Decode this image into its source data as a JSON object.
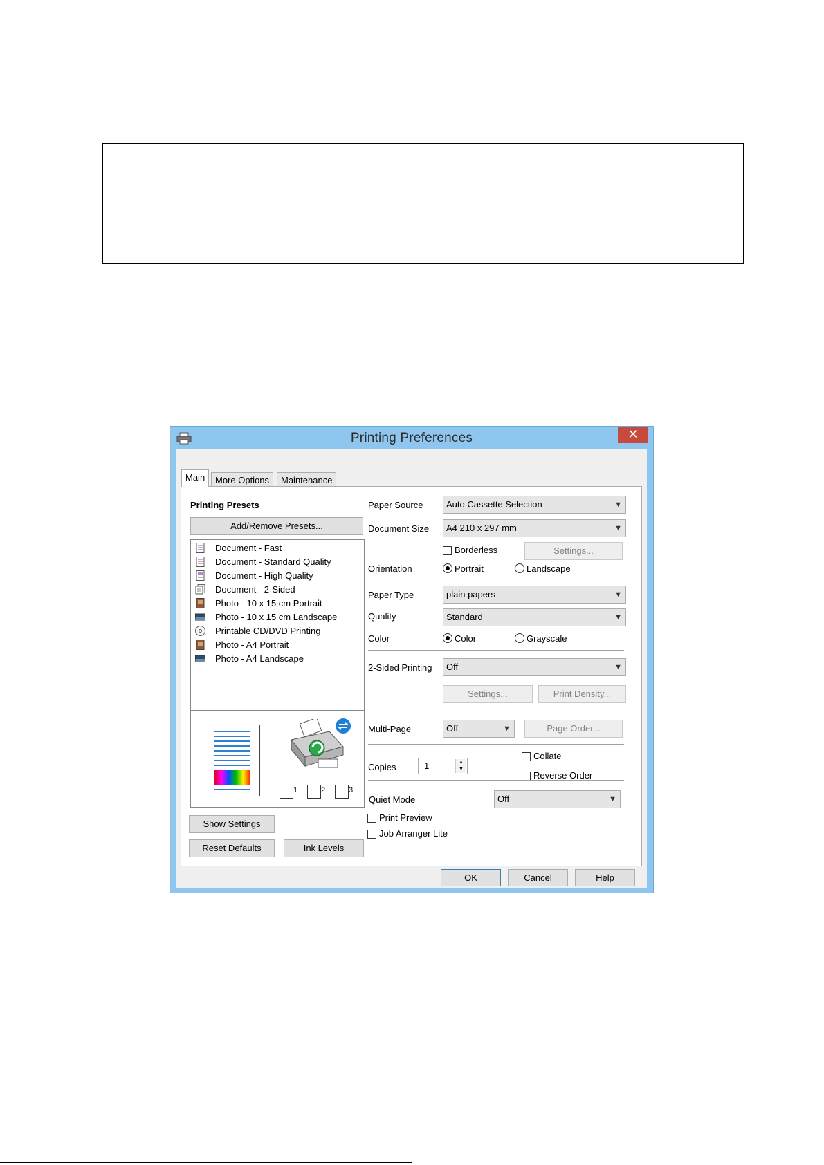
{
  "window": {
    "title": "Printing Preferences",
    "close_glyph": "✕"
  },
  "tabs": [
    {
      "label": "Main",
      "active": true
    },
    {
      "label": "More Options",
      "active": false
    },
    {
      "label": "Maintenance",
      "active": false
    }
  ],
  "presets": {
    "heading": "Printing Presets",
    "add_remove_label": "Add/Remove Presets...",
    "items": [
      {
        "label": "Document - Fast",
        "icon": "document-icon"
      },
      {
        "label": "Document - Standard Quality",
        "icon": "document-icon"
      },
      {
        "label": "Document - High Quality",
        "icon": "document-icon"
      },
      {
        "label": "Document - 2-Sided",
        "icon": "two-sided-document-icon"
      },
      {
        "label": "Photo - 10 x 15 cm Portrait",
        "icon": "photo-portrait-icon"
      },
      {
        "label": "Photo - 10 x 15 cm Landscape",
        "icon": "photo-landscape-icon"
      },
      {
        "label": "Printable CD/DVD Printing",
        "icon": "cd-dvd-icon"
      },
      {
        "label": "Photo - A4 Portrait",
        "icon": "photo-portrait-icon"
      },
      {
        "label": "Photo - A4 Landscape",
        "icon": "photo-landscape-icon"
      }
    ]
  },
  "preview": {
    "copy_numbers": [
      "1",
      "2",
      "3"
    ]
  },
  "left_buttons": {
    "show_settings": "Show Settings",
    "reset_defaults": "Reset Defaults",
    "ink_levels": "Ink Levels"
  },
  "settings": {
    "paper_source": {
      "label": "Paper Source",
      "value": "Auto Cassette Selection"
    },
    "document_size": {
      "label": "Document Size",
      "value": "A4 210 x 297 mm"
    },
    "borderless": {
      "label": "Borderless",
      "checked": false
    },
    "borderless_settings": "Settings...",
    "orientation": {
      "label": "Orientation",
      "options": [
        "Portrait",
        "Landscape"
      ],
      "selected": "Portrait"
    },
    "paper_type": {
      "label": "Paper Type",
      "value": "plain papers"
    },
    "quality": {
      "label": "Quality",
      "value": "Standard"
    },
    "color": {
      "label": "Color",
      "options": [
        "Color",
        "Grayscale"
      ],
      "selected": "Color"
    },
    "two_sided": {
      "label": "2-Sided Printing",
      "value": "Off"
    },
    "two_sided_settings": "Settings...",
    "print_density": "Print Density...",
    "multi_page": {
      "label": "Multi-Page",
      "value": "Off"
    },
    "page_order": "Page Order...",
    "copies": {
      "label": "Copies",
      "value": "1"
    },
    "collate": {
      "label": "Collate",
      "checked": false
    },
    "reverse_order": {
      "label": "Reverse Order",
      "checked": false
    },
    "quiet_mode": {
      "label": "Quiet Mode",
      "value": "Off"
    },
    "print_preview": {
      "label": "Print Preview",
      "checked": false
    },
    "job_arranger": {
      "label": "Job Arranger Lite",
      "checked": false
    }
  },
  "dialog_buttons": {
    "ok": "OK",
    "cancel": "Cancel",
    "help": "Help"
  },
  "colors": {
    "frame": "#8fc6ef",
    "close": "#c74a3c",
    "ok_border": "#3c7fb1"
  }
}
